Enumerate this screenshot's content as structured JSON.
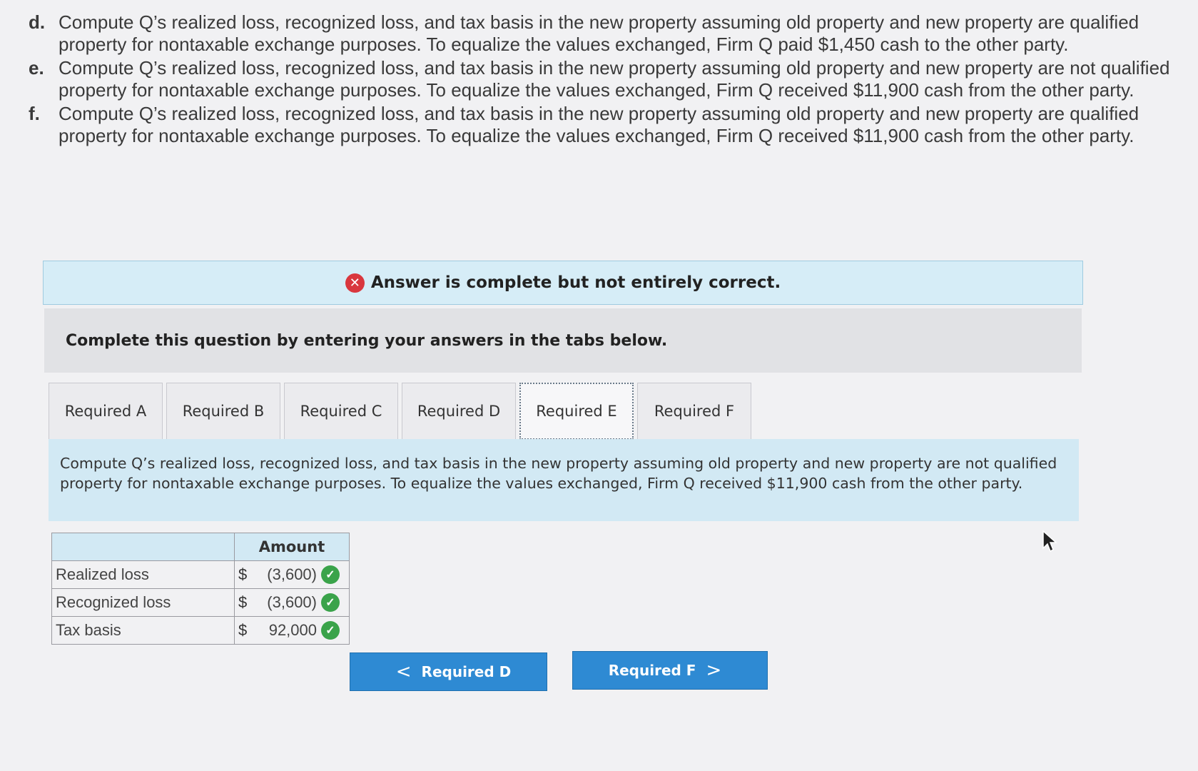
{
  "questions": [
    {
      "letter": "d.",
      "text": "Compute Q’s realized loss, recognized loss, and tax basis in the new property assuming old property and new property are qualified property for nontaxable exchange purposes. To equalize the values exchanged, Firm Q paid $1,450 cash to the other party."
    },
    {
      "letter": "e.",
      "text": "Compute Q’s realized loss, recognized loss, and tax basis in the new property assuming old property and new property are not qualified property for nontaxable exchange purposes. To equalize the values exchanged, Firm Q received $11,900 cash from the other party."
    },
    {
      "letter": "f.",
      "text": "Compute Q’s realized loss, recognized loss, and tax basis in the new property assuming old property and new property are qualified property for nontaxable exchange purposes. To equalize the values exchanged, Firm Q received $11,900 cash from the other party."
    }
  ],
  "banner": {
    "icon": "x-circle-icon",
    "text": "Answer is complete but not entirely correct."
  },
  "instruction": "Complete this question by entering your answers in the tabs below.",
  "tabs": [
    {
      "label": "Required A"
    },
    {
      "label": "Required B"
    },
    {
      "label": "Required C"
    },
    {
      "label": "Required D"
    },
    {
      "label": "Required E",
      "active": true
    },
    {
      "label": "Required F"
    }
  ],
  "panel_text": "Compute Q’s realized loss, recognized loss, and tax basis in the new property assuming old property and new property are not qualified property for nontaxable exchange purposes. To equalize the values exchanged, Firm Q received $11,900 cash from the other party.",
  "table": {
    "header": "Amount",
    "rows": [
      {
        "label": "Realized loss",
        "currency": "$",
        "value": "(3,600)",
        "status": "correct"
      },
      {
        "label": "Recognized loss",
        "currency": "$",
        "value": "(3,600)",
        "status": "correct"
      },
      {
        "label": "Tax basis",
        "currency": "$",
        "value": "92,000",
        "status": "correct"
      }
    ]
  },
  "nav": {
    "prev_label": "Required D",
    "next_label": "Required F"
  },
  "colors": {
    "accent": "#2e8ad3",
    "error": "#d9373e",
    "correct": "#3aa34a",
    "panel": "#d2e9f4"
  }
}
